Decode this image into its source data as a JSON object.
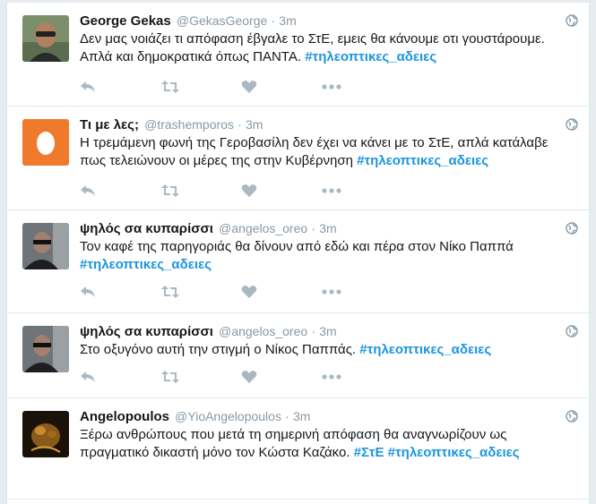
{
  "colors": {
    "background": "#e6ecf0",
    "text": "#14171a",
    "muted": "#8899a6",
    "hashtag": "#1b95e0",
    "icon": "#aab8c2",
    "border": "#e1e8ed"
  },
  "icons": {
    "reply": "reply-icon",
    "retweet": "retweet-icon",
    "like": "heart-icon",
    "more": "more-dots-icon",
    "privacy": "globe-icon"
  },
  "tweets": [
    {
      "name": "George Gekas",
      "handle": "@GekasGeorge",
      "dot": "·",
      "time": "3m",
      "parts": [
        "Δεν μας νοιάζει τι απόφαση έβγαλε το ΣτΕ, εμεις θα κάνουμε οτι γουστάρουμε. Απλά και δημοκρατικά όπως ΠΑΝΤΑ. ",
        "#τηλεοπτικες_αδειες"
      ]
    },
    {
      "name": "Τι με λες;",
      "handle": "@trashemporos",
      "dot": "·",
      "time": "3m",
      "parts": [
        "Η τρεμάμενη φωνή της Γεροβασίλη δεν έχει να κάνει με το ΣτΕ, απλά κατάλαβε πως τελειώνουν οι μέρες της στην Κυβέρνηση ",
        "#τηλεοπτικες_αδειες"
      ]
    },
    {
      "name": "ψηλός σα κυπαρίσσι",
      "handle": "@angelos_oreo",
      "dot": "·",
      "time": "3m",
      "parts": [
        "Τον καφέ της παρηγοριάς θα δίνουν από εδώ και πέρα στον Νίκο Παππά ",
        "#τηλεοπτικες_αδειες"
      ]
    },
    {
      "name": "ψηλός σα κυπαρίσσι",
      "handle": "@angelos_oreo",
      "dot": "·",
      "time": "3m",
      "parts": [
        "Στο οξυγόνο αυτή την στιγμή ο Νίκος Παππάς. ",
        "#τηλεοπτικες_αδειες"
      ]
    },
    {
      "name": "Angelopoulos",
      "handle": "@YioAngelopoulos",
      "dot": "·",
      "time": "3m",
      "parts": [
        "Ξέρω ανθρώπους που μετά τη σημερινή απόφαση θα αναγνωρίζουν ως πραγματικό δικαστή μόνο τον Κώστα Καζάκο. ",
        "#ΣτΕ",
        " ",
        "#τηλεοπτικες_αδειες"
      ]
    }
  ]
}
